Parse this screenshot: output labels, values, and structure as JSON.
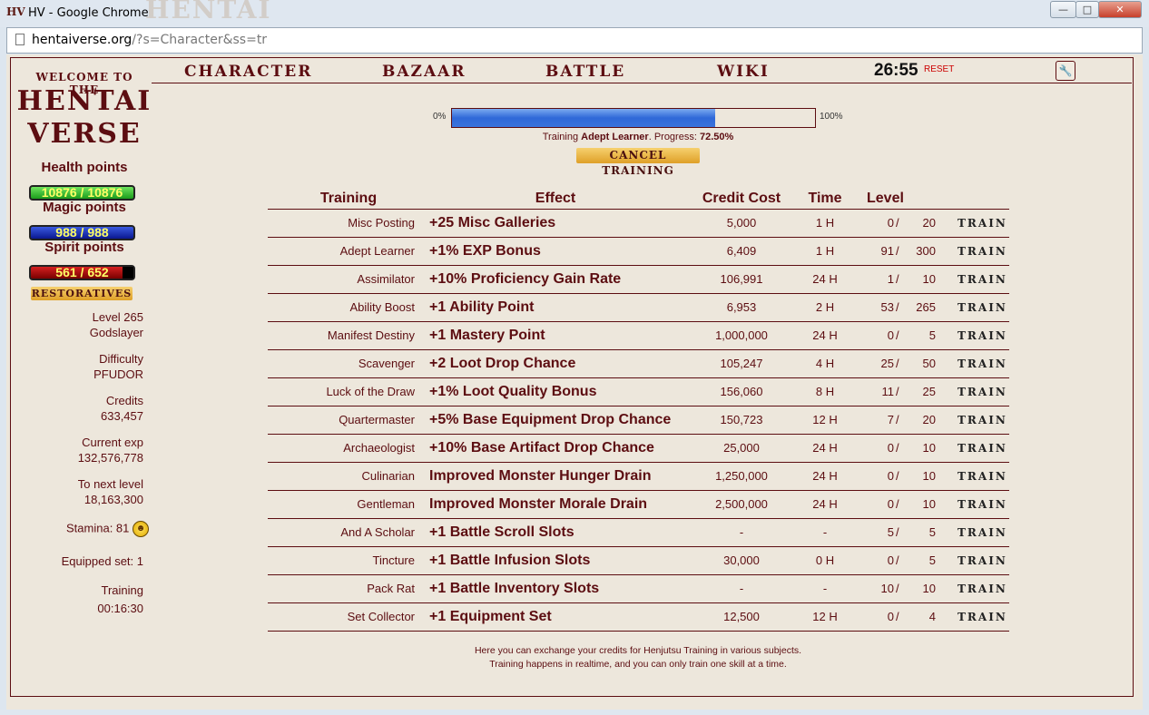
{
  "window": {
    "title": "HV - Google Chrome",
    "app_icon": "HV",
    "title_ghost": "HENTAI"
  },
  "address": {
    "host": "hentaiverse.org",
    "path": "/?s=Character&ss=tr"
  },
  "sidebar": {
    "welcome": "WELCOME TO THE",
    "logo_line1": "HENTAI",
    "logo_line2": "VERSE",
    "health_label": "Health points",
    "health_value": "10876 / 10876",
    "magic_label": "Magic points",
    "magic_value": "988 / 988",
    "spirit_label": "Spirit points",
    "spirit_value": "561 / 652",
    "restoratives_label": "RESTORATIVES",
    "level": "Level 265",
    "title": "Godslayer",
    "difficulty_label": "Difficulty",
    "difficulty_value": "PFUDOR",
    "credits_label": "Credits",
    "credits_value": "633,457",
    "exp_label": "Current exp",
    "exp_value": "132,576,778",
    "next_label": "To next level",
    "next_value": "18,163,300",
    "stamina": "Stamina: 81",
    "equipped": "Equipped set: 1",
    "training_label": "Training",
    "training_time": "00:16:30"
  },
  "nav": {
    "character": "CHARACTER",
    "bazaar": "BAZAAR",
    "battle": "BATTLE",
    "wiki": "WIKI",
    "timer": "26:55",
    "reset": "RESET"
  },
  "progress": {
    "left_label": "0%",
    "right_label": "100%",
    "fraction": 0.725,
    "status_prefix": "Training ",
    "skill": "Adept Learner",
    "status_mid": ". Progress: ",
    "percent": "72.50%",
    "cancel_label": "CANCEL TRAINING"
  },
  "table": {
    "headers": [
      "Training",
      "Effect",
      "Credit Cost",
      "Time",
      "Level"
    ],
    "action_label": "TRAIN",
    "rows": [
      {
        "name": "Misc Posting",
        "effect": "+25 Misc Galleries",
        "cost": "5,000",
        "time": "1 H",
        "cur": "0",
        "max": "20"
      },
      {
        "name": "Adept Learner",
        "effect": "+1% EXP Bonus",
        "cost": "6,409",
        "time": "1 H",
        "cur": "91",
        "max": "300"
      },
      {
        "name": "Assimilator",
        "effect": "+10% Proficiency Gain Rate",
        "cost": "106,991",
        "time": "24 H",
        "cur": "1",
        "max": "10"
      },
      {
        "name": "Ability Boost",
        "effect": "+1 Ability Point",
        "cost": "6,953",
        "time": "2 H",
        "cur": "53",
        "max": "265"
      },
      {
        "name": "Manifest Destiny",
        "effect": "+1 Mastery Point",
        "cost": "1,000,000",
        "time": "24 H",
        "cur": "0",
        "max": "5"
      },
      {
        "name": "Scavenger",
        "effect": "+2 Loot Drop Chance",
        "cost": "105,247",
        "time": "4 H",
        "cur": "25",
        "max": "50"
      },
      {
        "name": "Luck of the Draw",
        "effect": "+1% Loot Quality Bonus",
        "cost": "156,060",
        "time": "8 H",
        "cur": "11",
        "max": "25"
      },
      {
        "name": "Quartermaster",
        "effect": "+5% Base Equipment Drop Chance",
        "cost": "150,723",
        "time": "12 H",
        "cur": "7",
        "max": "20"
      },
      {
        "name": "Archaeologist",
        "effect": "+10% Base Artifact Drop Chance",
        "cost": "25,000",
        "time": "24 H",
        "cur": "0",
        "max": "10"
      },
      {
        "name": "Culinarian",
        "effect": "Improved Monster Hunger Drain",
        "cost": "1,250,000",
        "time": "24 H",
        "cur": "0",
        "max": "10"
      },
      {
        "name": "Gentleman",
        "effect": "Improved Monster Morale Drain",
        "cost": "2,500,000",
        "time": "24 H",
        "cur": "0",
        "max": "10"
      },
      {
        "name": "And A Scholar",
        "effect": "+1 Battle Scroll Slots",
        "cost": "-",
        "time": "-",
        "cur": "5",
        "max": "5"
      },
      {
        "name": "Tincture",
        "effect": "+1 Battle Infusion Slots",
        "cost": "30,000",
        "time": "0 H",
        "cur": "0",
        "max": "5"
      },
      {
        "name": "Pack Rat",
        "effect": "+1 Battle Inventory Slots",
        "cost": "-",
        "time": "-",
        "cur": "10",
        "max": "10"
      },
      {
        "name": "Set Collector",
        "effect": "+1 Equipment Set",
        "cost": "12,500",
        "time": "12 H",
        "cur": "0",
        "max": "4"
      }
    ]
  },
  "footer": {
    "line1": "Here you can exchange your credits for Henjutsu Training in various subjects.",
    "line2": "Training happens in realtime, and you can only train one skill at a time."
  }
}
